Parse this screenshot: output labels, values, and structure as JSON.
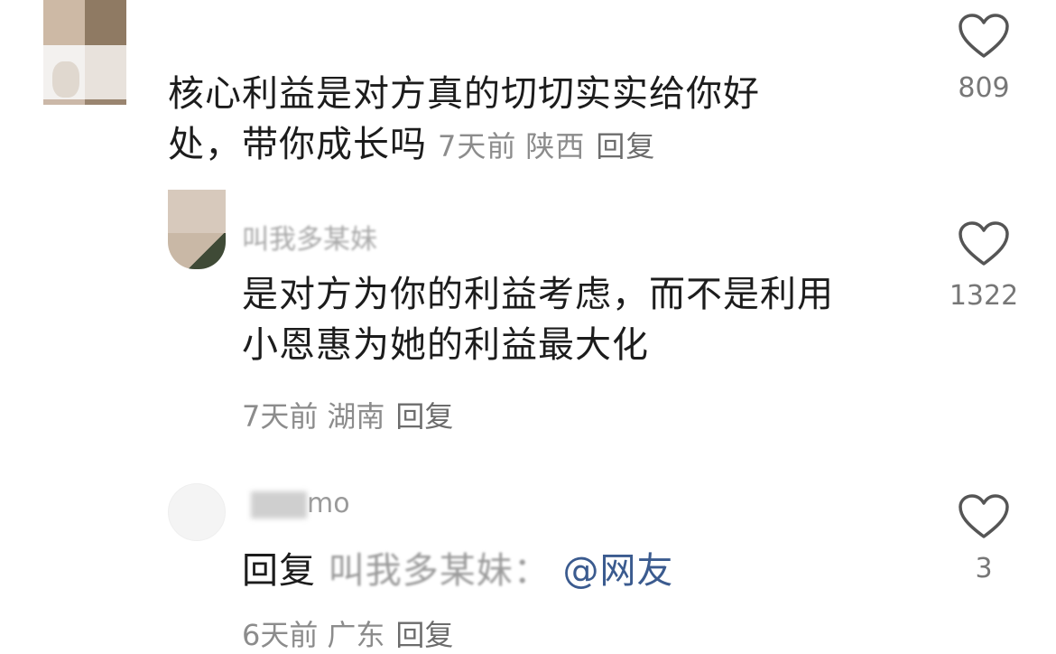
{
  "comments": [
    {
      "name": "",
      "text_line1": "核心利益是对方真的切切实实给你好",
      "text_line2": "处，带你成长吗",
      "time": "7天前",
      "location": "陕西",
      "reply": "回复",
      "likes": "809"
    },
    {
      "name": "叫我多某妹",
      "text_line1": "是对方为你的利益考虑，而不是利用",
      "text_line2": "小恩惠为她的利益最大化",
      "time": "7天前",
      "location": "湖南",
      "reply": "回复",
      "likes": "1322"
    },
    {
      "name": "mo",
      "reply_prefix": "回复",
      "reply_target": "叫我多某妹：",
      "mention": "@网友",
      "time": "6天前",
      "location": "广东",
      "reply": "回复",
      "likes": "3"
    }
  ]
}
